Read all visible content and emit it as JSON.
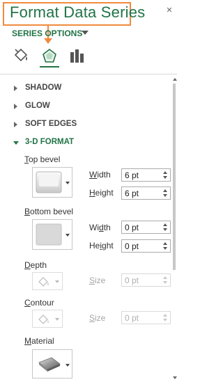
{
  "pane": {
    "title": "Format Data Series",
    "close_glyph": "✕"
  },
  "series_options": {
    "label": "SERIES OPTIONS"
  },
  "tabs": [
    {
      "name": "fill-line",
      "icon": "paint-bucket-icon",
      "selected": false
    },
    {
      "name": "effects",
      "icon": "pentagon-icon",
      "selected": true
    },
    {
      "name": "series-options",
      "icon": "bar-chart-icon",
      "selected": false
    }
  ],
  "sections": {
    "shadow": "SHADOW",
    "glow": "GLOW",
    "soft_edges": "SOFT EDGES",
    "three_d_format": "3-D FORMAT"
  },
  "three_d": {
    "top_bevel_pre": "",
    "top_bevel_u": "T",
    "top_bevel_post": "op bevel",
    "bottom_bevel_pre": "",
    "bottom_bevel_u": "B",
    "bottom_bevel_post": "ottom bevel",
    "top_width_label_pre": "",
    "top_width_label_u": "W",
    "top_width_label_post": "idth",
    "top_width_value": "6 pt",
    "top_height_label_pre": "",
    "top_height_label_u": "H",
    "top_height_label_post": "eight",
    "top_height_value": "6 pt",
    "bottom_width_label_pre": "Wi",
    "bottom_width_label_u": "d",
    "bottom_width_label_post": "th",
    "bottom_width_value": "0 pt",
    "bottom_height_label_pre": "He",
    "bottom_height_label_u": "i",
    "bottom_height_label_post": "ght",
    "bottom_height_value": "0 pt",
    "depth_label_pre": "",
    "depth_label_u": "D",
    "depth_label_post": "epth",
    "depth_size_label_pre": "",
    "depth_size_label_u": "S",
    "depth_size_label_post": "ize",
    "depth_size_value": "0 pt",
    "contour_label_pre": "",
    "contour_label_u": "C",
    "contour_label_post": "ontour",
    "contour_size_label_pre": "",
    "contour_size_label_u": "S",
    "contour_size_label_post": "ize",
    "contour_size_value": "0 pt",
    "material_label_pre": "",
    "material_label_u": "M",
    "material_label_post": "aterial"
  },
  "colors": {
    "accent": "#217346",
    "highlight": "#f08a3c"
  }
}
